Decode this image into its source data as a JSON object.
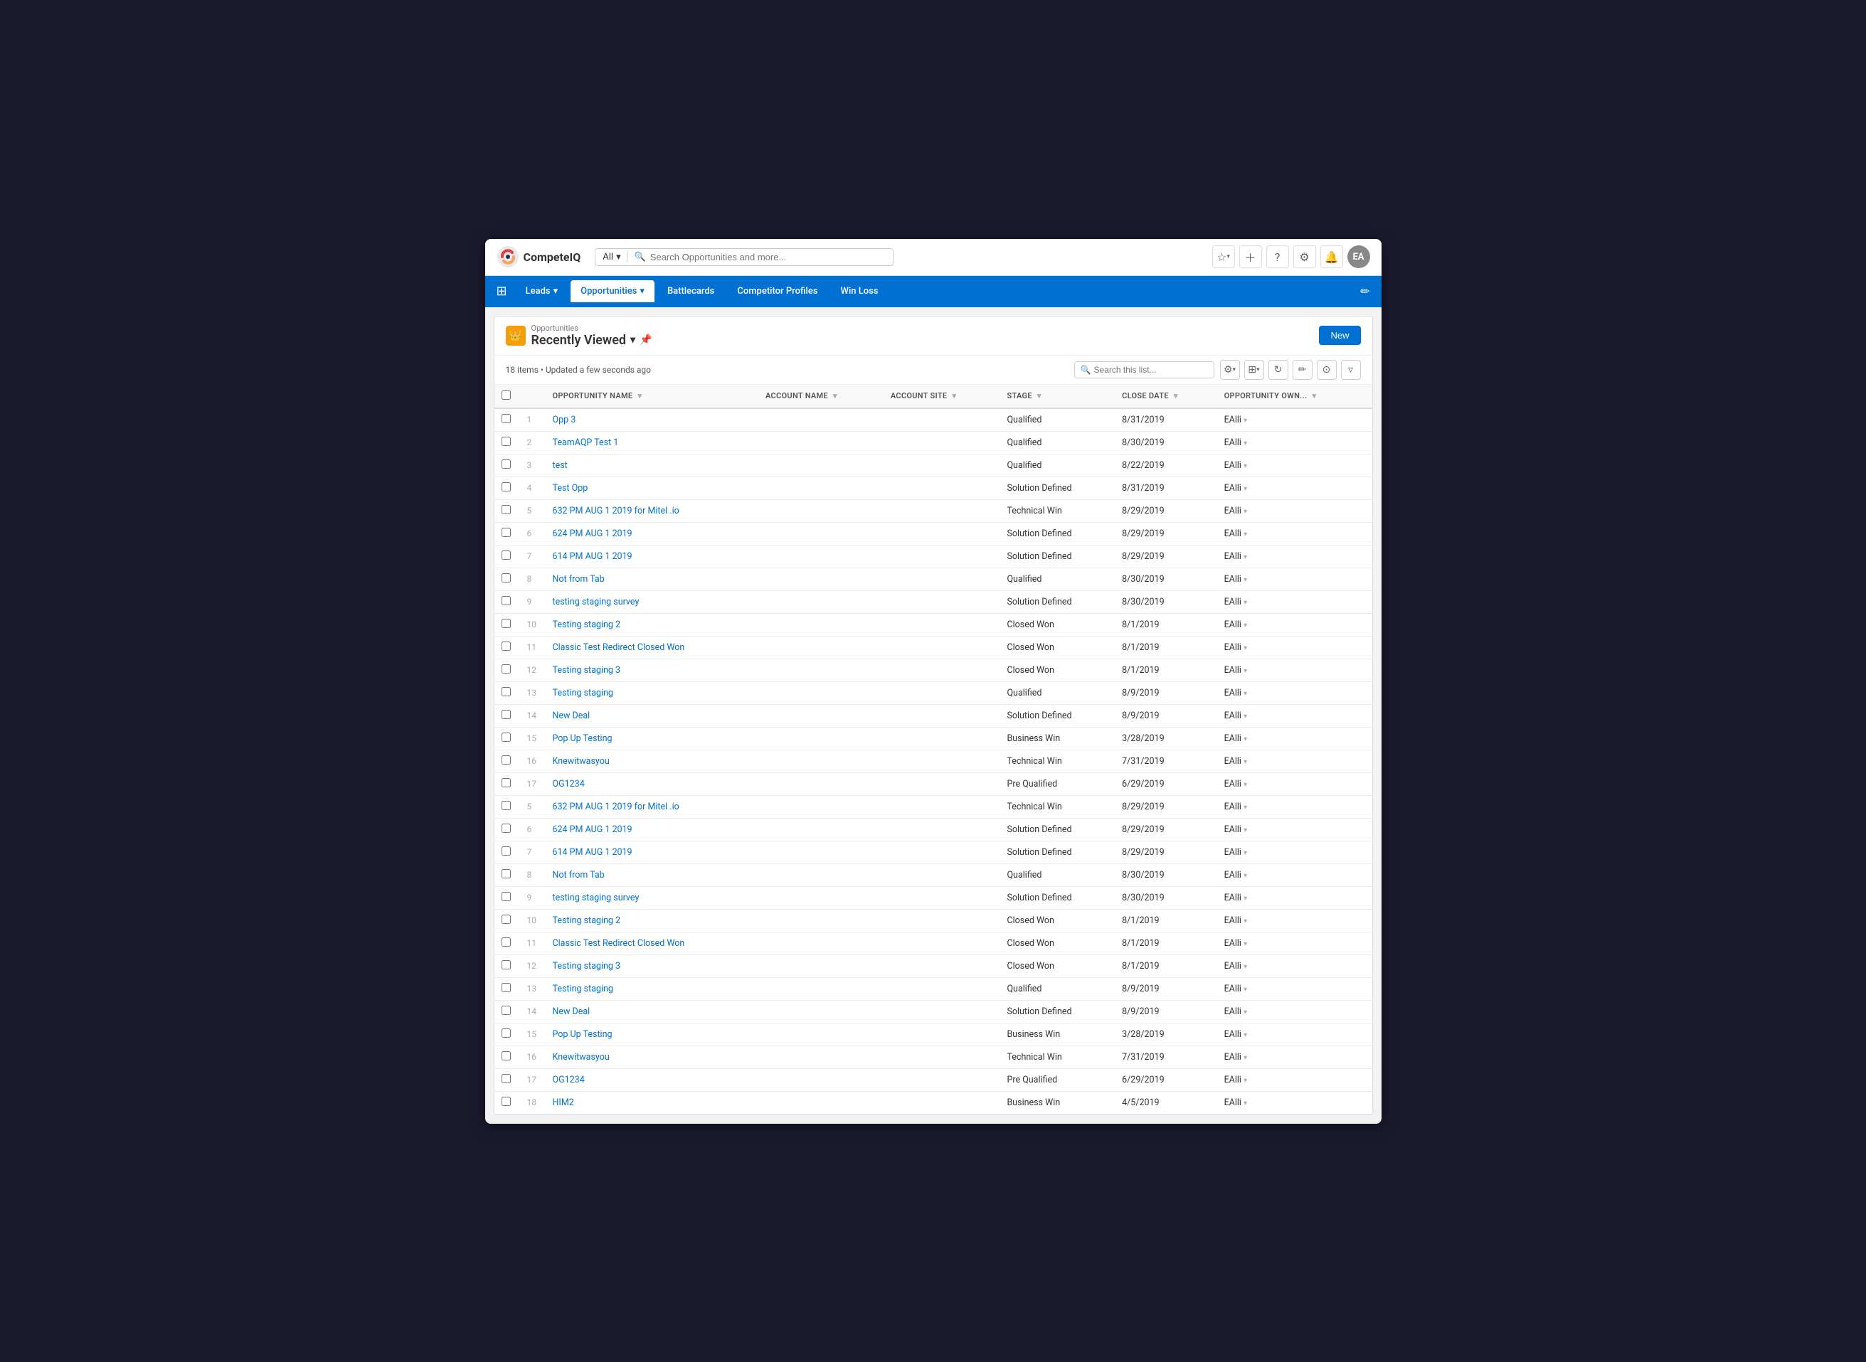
{
  "app": {
    "logo_text": "CompeteIQ",
    "window_title": "Opportunities - Recently Viewed"
  },
  "topbar": {
    "search_dropdown": "All",
    "search_placeholder": "Search Opportunities and more...",
    "icons": [
      "star",
      "favorites",
      "plus",
      "help",
      "settings",
      "bell",
      "avatar"
    ]
  },
  "navbar": {
    "items": [
      {
        "label": "Leads",
        "has_chevron": true,
        "active": false
      },
      {
        "label": "Opportunities",
        "has_chevron": true,
        "active": true
      },
      {
        "label": "Battlecards",
        "has_chevron": false,
        "active": false
      },
      {
        "label": "Competitor Profiles",
        "has_chevron": false,
        "active": false
      },
      {
        "label": "Win Loss",
        "has_chevron": false,
        "active": false
      }
    ]
  },
  "list_view": {
    "breadcrumb": "Opportunities",
    "title": "Recently Viewed",
    "new_button": "New",
    "item_count": "18 items • Updated a few seconds ago",
    "search_placeholder": "Search this list...",
    "columns": [
      {
        "key": "name",
        "label": "OPPORTUNITY NAME"
      },
      {
        "key": "account_name",
        "label": "ACCOUNT NAME"
      },
      {
        "key": "account_site",
        "label": "ACCOUNT SITE"
      },
      {
        "key": "stage",
        "label": "STAGE"
      },
      {
        "key": "close_date",
        "label": "CLOSE DATE"
      },
      {
        "key": "owner",
        "label": "OPPORTUNITY OWN..."
      }
    ],
    "rows": [
      {
        "num": 1,
        "name": "Opp 3",
        "account_name": "",
        "account_site": "",
        "stage": "Qualified",
        "close_date": "8/31/2019",
        "owner": "EAlli"
      },
      {
        "num": 2,
        "name": "TeamAQP Test 1",
        "account_name": "",
        "account_site": "",
        "stage": "Qualified",
        "close_date": "8/30/2019",
        "owner": "EAlli"
      },
      {
        "num": 3,
        "name": "test",
        "account_name": "",
        "account_site": "",
        "stage": "Qualified",
        "close_date": "8/22/2019",
        "owner": "EAlli"
      },
      {
        "num": 4,
        "name": "Test Opp",
        "account_name": "",
        "account_site": "",
        "stage": "Solution Defined",
        "close_date": "8/31/2019",
        "owner": "EAlli"
      },
      {
        "num": 5,
        "name": "632 PM AUG 1 2019 for Mitel .io",
        "account_name": "",
        "account_site": "",
        "stage": "Technical Win",
        "close_date": "8/29/2019",
        "owner": "EAlli"
      },
      {
        "num": 6,
        "name": "624 PM AUG 1 2019",
        "account_name": "",
        "account_site": "",
        "stage": "Solution Defined",
        "close_date": "8/29/2019",
        "owner": "EAlli"
      },
      {
        "num": 7,
        "name": "614 PM AUG 1 2019",
        "account_name": "",
        "account_site": "",
        "stage": "Solution Defined",
        "close_date": "8/29/2019",
        "owner": "EAlli"
      },
      {
        "num": 8,
        "name": "Not from Tab",
        "account_name": "",
        "account_site": "",
        "stage": "Qualified",
        "close_date": "8/30/2019",
        "owner": "EAlli"
      },
      {
        "num": 9,
        "name": "testing staging survey",
        "account_name": "",
        "account_site": "",
        "stage": "Solution Defined",
        "close_date": "8/30/2019",
        "owner": "EAlli"
      },
      {
        "num": 10,
        "name": "Testing staging 2",
        "account_name": "",
        "account_site": "",
        "stage": "Closed Won",
        "close_date": "8/1/2019",
        "owner": "EAlli"
      },
      {
        "num": 11,
        "name": "Classic Test Redirect Closed Won",
        "account_name": "",
        "account_site": "",
        "stage": "Closed Won",
        "close_date": "8/1/2019",
        "owner": "EAlli"
      },
      {
        "num": 12,
        "name": "Testing staging 3",
        "account_name": "",
        "account_site": "",
        "stage": "Closed Won",
        "close_date": "8/1/2019",
        "owner": "EAlli"
      },
      {
        "num": 13,
        "name": "Testing staging",
        "account_name": "",
        "account_site": "",
        "stage": "Qualified",
        "close_date": "8/9/2019",
        "owner": "EAlli"
      },
      {
        "num": 14,
        "name": "New Deal",
        "account_name": "",
        "account_site": "",
        "stage": "Solution Defined",
        "close_date": "8/9/2019",
        "owner": "EAlli"
      },
      {
        "num": 15,
        "name": "Pop Up Testing",
        "account_name": "",
        "account_site": "",
        "stage": "Business Win",
        "close_date": "3/28/2019",
        "owner": "EAlli"
      },
      {
        "num": 16,
        "name": "Knewitwasyou",
        "account_name": "",
        "account_site": "",
        "stage": "Technical Win",
        "close_date": "7/31/2019",
        "owner": "EAlli"
      },
      {
        "num": 17,
        "name": "OG1234",
        "account_name": "",
        "account_site": "",
        "stage": "Pre Qualified",
        "close_date": "6/29/2019",
        "owner": "EAlli"
      },
      {
        "num": 5,
        "name": "632 PM AUG 1 2019 for Mitel .io",
        "account_name": "",
        "account_site": "",
        "stage": "Technical Win",
        "close_date": "8/29/2019",
        "owner": "EAlli"
      },
      {
        "num": 6,
        "name": "624 PM AUG 1 2019",
        "account_name": "",
        "account_site": "",
        "stage": "Solution Defined",
        "close_date": "8/29/2019",
        "owner": "EAlli"
      },
      {
        "num": 7,
        "name": "614 PM AUG 1 2019",
        "account_name": "",
        "account_site": "",
        "stage": "Solution Defined",
        "close_date": "8/29/2019",
        "owner": "EAlli"
      },
      {
        "num": 8,
        "name": "Not from Tab",
        "account_name": "",
        "account_site": "",
        "stage": "Qualified",
        "close_date": "8/30/2019",
        "owner": "EAlli"
      },
      {
        "num": 9,
        "name": "testing staging survey",
        "account_name": "",
        "account_site": "",
        "stage": "Solution Defined",
        "close_date": "8/30/2019",
        "owner": "EAlli"
      },
      {
        "num": 10,
        "name": "Testing staging 2",
        "account_name": "",
        "account_site": "",
        "stage": "Closed Won",
        "close_date": "8/1/2019",
        "owner": "EAlli"
      },
      {
        "num": 11,
        "name": "Classic Test Redirect Closed Won",
        "account_name": "",
        "account_site": "",
        "stage": "Closed Won",
        "close_date": "8/1/2019",
        "owner": "EAlli"
      },
      {
        "num": 12,
        "name": "Testing staging 3",
        "account_name": "",
        "account_site": "",
        "stage": "Closed Won",
        "close_date": "8/1/2019",
        "owner": "EAlli"
      },
      {
        "num": 13,
        "name": "Testing staging",
        "account_name": "",
        "account_site": "",
        "stage": "Qualified",
        "close_date": "8/9/2019",
        "owner": "EAlli"
      },
      {
        "num": 14,
        "name": "New Deal",
        "account_name": "",
        "account_site": "",
        "stage": "Solution Defined",
        "close_date": "8/9/2019",
        "owner": "EAlli"
      },
      {
        "num": 15,
        "name": "Pop Up Testing",
        "account_name": "",
        "account_site": "",
        "stage": "Business Win",
        "close_date": "3/28/2019",
        "owner": "EAlli"
      },
      {
        "num": 16,
        "name": "Knewitwasyou",
        "account_name": "",
        "account_site": "",
        "stage": "Technical Win",
        "close_date": "7/31/2019",
        "owner": "EAlli"
      },
      {
        "num": 17,
        "name": "OG1234",
        "account_name": "",
        "account_site": "",
        "stage": "Pre Qualified",
        "close_date": "6/29/2019",
        "owner": "EAlli"
      },
      {
        "num": 18,
        "name": "HIM2",
        "account_name": "",
        "account_site": "",
        "stage": "Business Win",
        "close_date": "4/5/2019",
        "owner": "EAlli"
      }
    ]
  }
}
